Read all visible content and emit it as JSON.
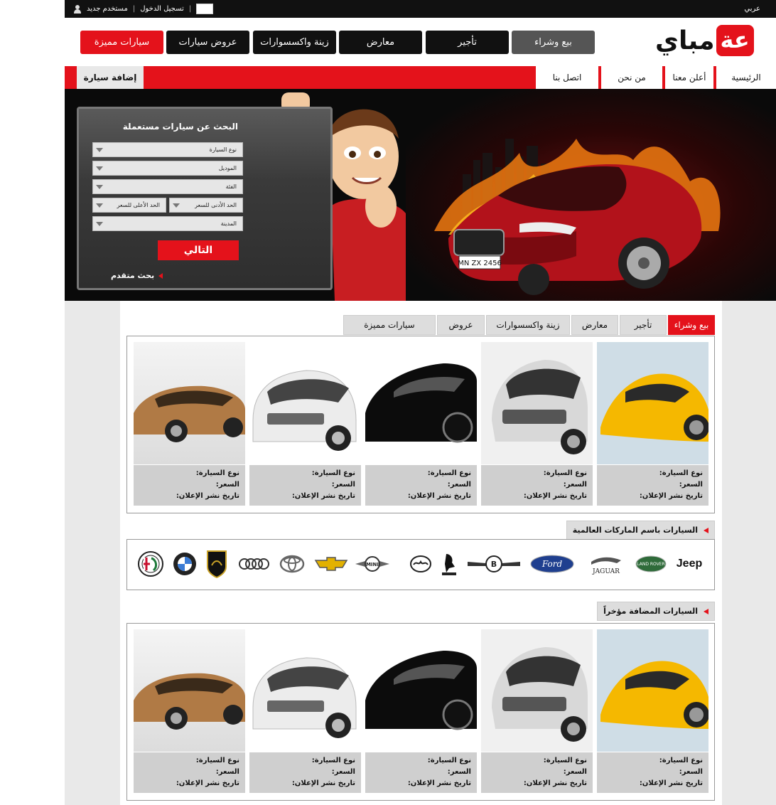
{
  "topbar": {
    "language": "عربي",
    "new_user": "مستخدم جديد",
    "login": "تسجيل الدخول"
  },
  "logo": {
    "text": "مباي",
    "badge": "عة"
  },
  "main_nav": [
    {
      "label": "بيع وشراء",
      "active": true
    },
    {
      "label": "تأجير"
    },
    {
      "label": "معارض"
    },
    {
      "label": "زينة واكسسوارات"
    },
    {
      "label": "عروض سيارات"
    },
    {
      "label": "سيارات مميزة",
      "highlight": true
    }
  ],
  "menu": {
    "items": [
      "الرئيسية",
      "أعلن معنا",
      "من نحن",
      "اتصل بنا"
    ],
    "add_car": "إضافة سيارة"
  },
  "search": {
    "title": "البحث عن سيارات مستعملة",
    "car_type": "نوع السيارة",
    "model": "الموديل",
    "category": "الفئة",
    "min_price": "الحد الأدنى للسعر",
    "max_price": "الحد الأعلى للسعر",
    "city": "المدينة",
    "next": "التالي",
    "advanced": "بحث متقدم"
  },
  "hero": {
    "plate": "MN ZX 2456"
  },
  "tabs": [
    "بيع وشراء",
    "تأجير",
    "معارض",
    "زينة واكسسوارات",
    "عروض",
    "سيارات مميزة"
  ],
  "card_labels": {
    "car_type": "نوع السيارة:",
    "price": "السعر:",
    "date": "تاريخ نشر الإعلان:"
  },
  "brands_section": {
    "title": "السيارات باسم الماركات العالمية",
    "brands": [
      "Jeep",
      "LAND ROVER",
      "JAGUAR",
      "Ford",
      "Bentley",
      "Ferrari",
      "Mazda",
      "MINI",
      "Chevrolet",
      "Toyota",
      "Audi",
      "Lamborghini",
      "BMW",
      "Alfa Romeo"
    ],
    "jeep_text": "Jeep",
    "jaguar_text": "JAGUAR",
    "ford_text": "Ford",
    "mini_text": "MINI",
    "landrover_text": "LAND ROVER"
  },
  "recent_section": {
    "title": "السيارات المضافة مؤخراً"
  },
  "colors": {
    "brand_red": "#e4121b",
    "dark": "#111111"
  }
}
